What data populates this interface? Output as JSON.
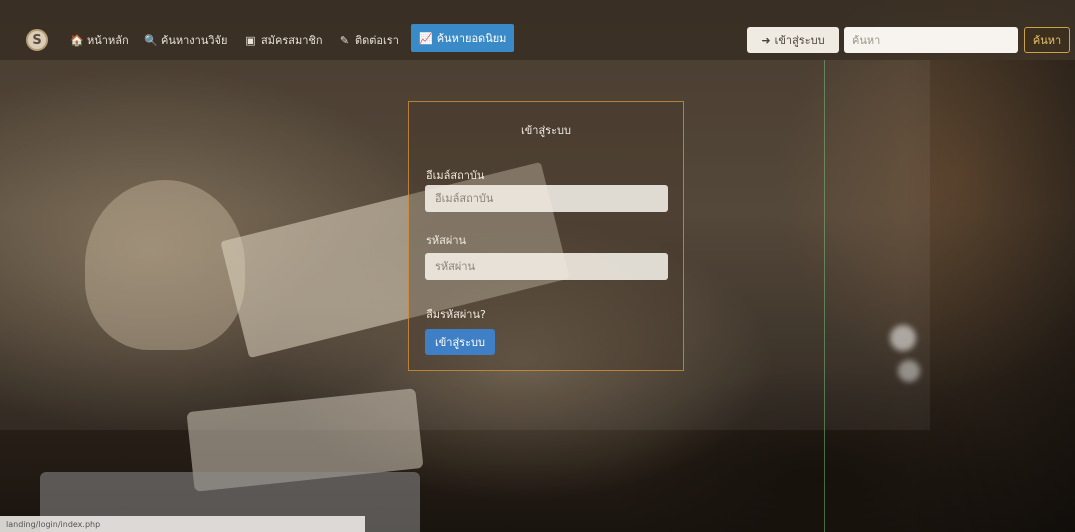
{
  "navbar": {
    "brand_letter": "S",
    "items": [
      {
        "label": "หน้าหลัก",
        "icon": "home-icon",
        "glyph": "🏠"
      },
      {
        "label": "ค้นหางานวิจัย",
        "icon": "search-icon",
        "glyph": "🔍"
      },
      {
        "label": "สมัครสมาชิก",
        "icon": "id-card-icon",
        "glyph": "▣"
      },
      {
        "label": "ติดต่อเรา",
        "icon": "edit-icon",
        "glyph": "✎"
      }
    ],
    "active_item": {
      "label": "ค้นหายอดนิยม",
      "icon": "chart-line-icon",
      "glyph": "📈"
    },
    "login": {
      "label": "เข้าสู่ระบบ",
      "icon": "sign-in-icon",
      "glyph": "➜"
    },
    "search": {
      "placeholder": "ค้นหา",
      "button_label": "ค้นหา"
    }
  },
  "login_form": {
    "title": "เข้าสู่ระบบ",
    "email_label": "อีเมล์สถาบัน",
    "email_placeholder": "อีเมล์สถาบัน",
    "password_label": "รหัสผ่าน",
    "password_placeholder": "รหัสผ่าน",
    "forgot_label": "ลืมรหัสผ่าน?",
    "submit_label": "เข้าสู่ระบบ"
  },
  "statusbar": {
    "url": "landing/login/index.php"
  },
  "colors": {
    "accent": "#3b8ac8",
    "card_border": "#dc963c",
    "search_button": "#c9a24a"
  }
}
